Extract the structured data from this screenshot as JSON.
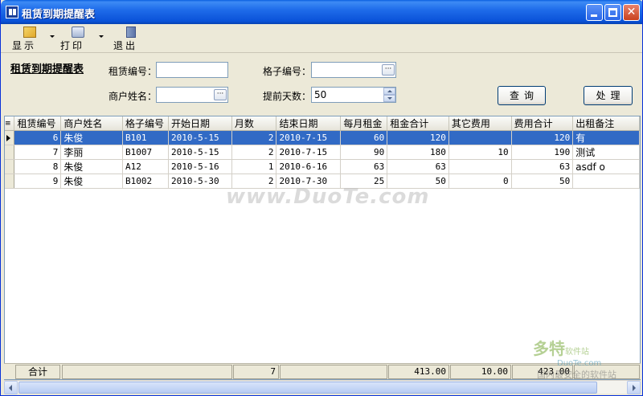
{
  "window": {
    "title": "租赁到期提醒表"
  },
  "toolbar": {
    "show_label": "显示",
    "print_label": "打印",
    "exit_label": "退出"
  },
  "query": {
    "panel_title": "租赁到期提醒表",
    "lease_no_label": "租赁编号：",
    "lease_no_value": "",
    "cell_no_label": "格子编号：",
    "cell_no_value": "",
    "merchant_label": "商户姓名：",
    "merchant_value": "",
    "advance_days_label": "提前天数：",
    "advance_days_value": "50",
    "query_button": "查询",
    "process_button": "处理"
  },
  "grid": {
    "indicator_header": "≡",
    "columns": [
      "租赁编号",
      "商户姓名",
      "格子编号",
      "开始日期",
      "月数",
      "结束日期",
      "每月租金",
      "租金合计",
      "其它费用",
      "费用合计",
      "出租备注"
    ],
    "rows": [
      [
        "6",
        "朱俊",
        "B101",
        "2010-5-15",
        "2",
        "2010-7-15",
        "60",
        "120",
        "",
        "120",
        "有"
      ],
      [
        "7",
        "李丽",
        "B1007",
        "2010-5-15",
        "2",
        "2010-7-15",
        "90",
        "180",
        "10",
        "190",
        "测试"
      ],
      [
        "8",
        "朱俊",
        "A12",
        "2010-5-16",
        "1",
        "2010-6-16",
        "63",
        "63",
        "",
        "63",
        "asdf o"
      ],
      [
        "9",
        "朱俊",
        "B1002",
        "2010-5-30",
        "2",
        "2010-7-30",
        "25",
        "50",
        "0",
        "50",
        ""
      ]
    ],
    "selected_row": 0
  },
  "footer": {
    "total_label": "合计",
    "months_total": "7",
    "rent_total": "413.00",
    "other_total": "10.00",
    "fee_total": "423.00"
  },
  "watermark": {
    "main": "www.DuoTe.com",
    "logo_big": "多特",
    "logo_small": "软件站",
    "logo_url": "DuoTe.com",
    "logo_caption": "国内最安全的软件站"
  }
}
